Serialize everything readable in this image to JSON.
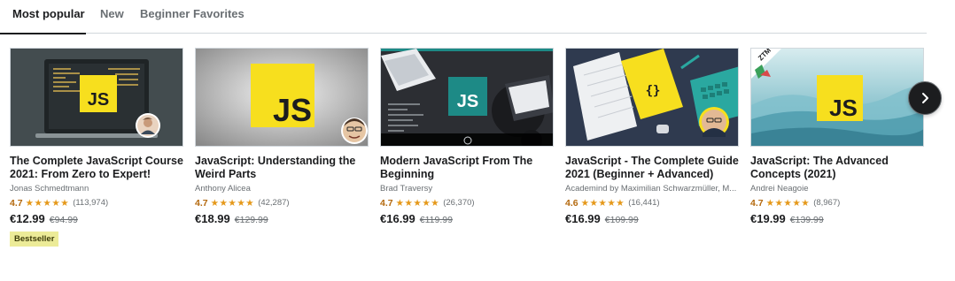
{
  "tabs": [
    {
      "label": "Most popular",
      "active": true
    },
    {
      "label": "New",
      "active": false
    },
    {
      "label": "Beginner Favorites",
      "active": false
    }
  ],
  "courses": [
    {
      "title": "The Complete JavaScript Course 2021: From Zero to Expert!",
      "thumb_text": "JS",
      "author": "Jonas Schmedtmann",
      "rating": "4.7",
      "stars": "★★★★★",
      "reviews": "(113,974)",
      "price": "€12.99",
      "old_price": "€94.99",
      "badge": "Bestseller"
    },
    {
      "title": "JavaScript: Understanding the Weird Parts",
      "thumb_text": "JS",
      "author": "Anthony Alicea",
      "rating": "4.7",
      "stars": "★★★★★",
      "reviews": "(42,287)",
      "price": "€18.99",
      "old_price": "€129.99"
    },
    {
      "title": "Modern JavaScript From The Beginning",
      "thumb_text": "JS",
      "author": "Brad Traversy",
      "rating": "4.7",
      "stars": "★★★★★",
      "reviews": "(26,370)",
      "price": "€16.99",
      "old_price": "€119.99"
    },
    {
      "title": "JavaScript - The Complete Guide 2021 (Beginner + Advanced)",
      "thumb_text": "{}",
      "author": "Academind by Maximilian Schwarzmüller, M...",
      "rating": "4.6",
      "stars": "★★★★★",
      "reviews": "(16,441)",
      "price": "€16.99",
      "old_price": "€109.99"
    },
    {
      "title": "JavaScript: The Advanced Concepts (2021)",
      "thumb_text": "JS",
      "thumb_ribbon": "ZTM",
      "author": "Andrei Neagoie",
      "rating": "4.7",
      "stars": "★★★★★",
      "reviews": "(8,967)",
      "price": "€19.99",
      "old_price": "€139.99"
    }
  ],
  "icons": {
    "next": "chevron-right-icon"
  },
  "colors": {
    "accent_rating": "#b4690e",
    "stars": "#e59819",
    "badge_bg": "#eceb98",
    "js_yellow": "#f7df1e",
    "js_teal": "#1d8a86"
  }
}
